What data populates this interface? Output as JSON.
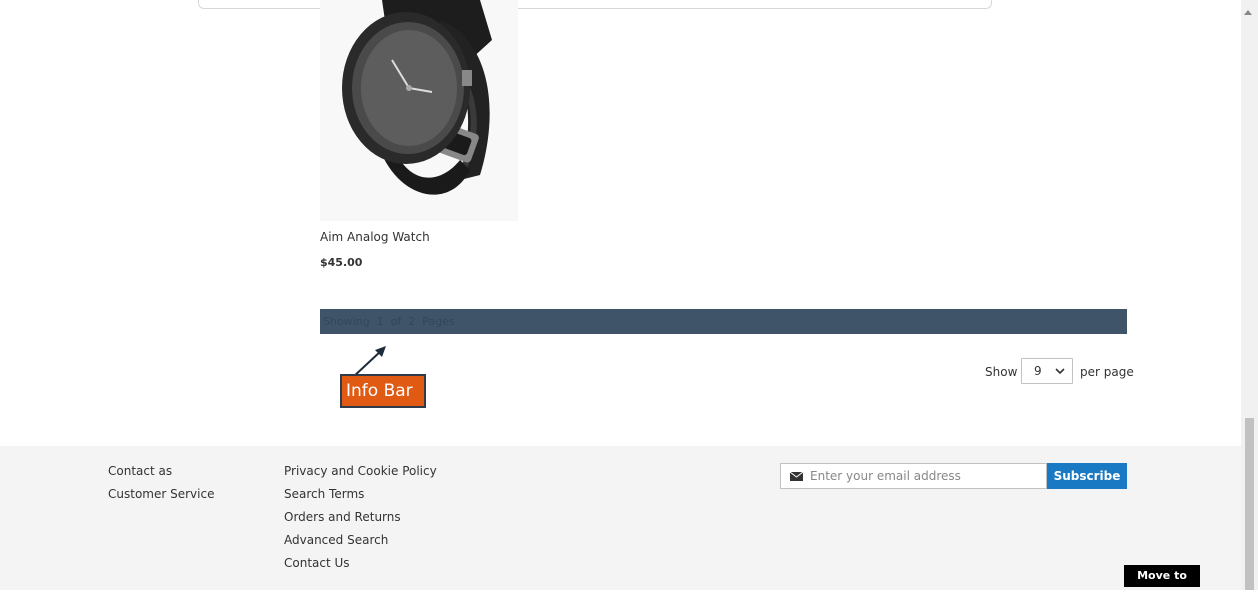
{
  "product": {
    "name": "Aim Analog Watch",
    "price": "$45.00",
    "image_icon": "watch-product-image"
  },
  "toolbar": {
    "info_text": "Showing  1  of  2  Pages",
    "limiter_show": "Show",
    "limiter_value": "9",
    "limiter_per_page": "per page"
  },
  "annotation": {
    "label": "Info Bar"
  },
  "footer": {
    "col1": [
      "Contact as",
      "Customer Service"
    ],
    "col2": [
      "Privacy and Cookie Policy",
      "Search Terms",
      "Orders and Returns",
      "Advanced Search",
      "Contact Us"
    ],
    "newsletter_placeholder": "Enter your email address",
    "subscribe_label": "Subscribe"
  },
  "move_to_top": "Move to Top!",
  "colors": {
    "info_bar": "#3f5468",
    "annotation_bg": "#e05a14",
    "subscribe": "#1979c3",
    "footer_bg": "#f4f4f4"
  }
}
